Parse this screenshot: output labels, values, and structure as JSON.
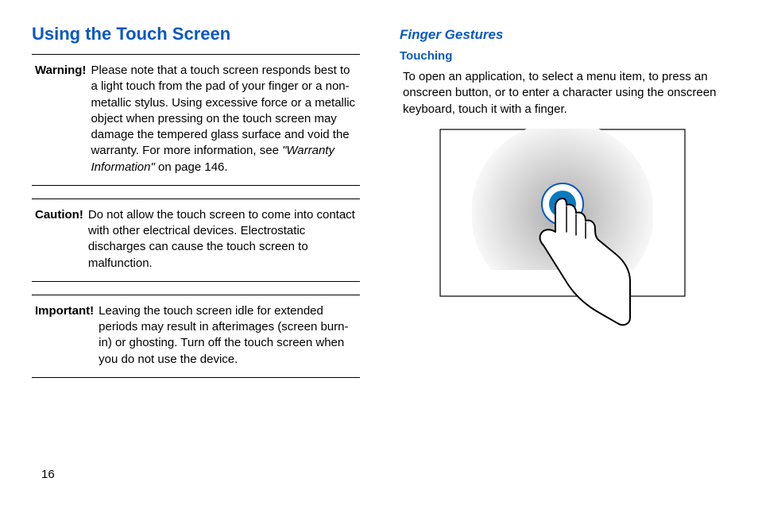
{
  "page_number": "16",
  "left": {
    "section_title": "Using the Touch Screen",
    "warning": {
      "label": "Warning!",
      "text_a": "Please note that a touch screen responds best to a light touch from the pad of your finger or a non-metallic stylus. Using excessive force or a metallic object when pressing on the touch screen may damage the tempered glass surface and void the warranty. For more information, see ",
      "text_i": "\"Warranty Information\"",
      "text_b": " on page 146."
    },
    "caution": {
      "label": "Caution!",
      "text": "Do not allow the touch screen to come into contact with other electrical devices. Electrostatic discharges can cause the touch screen to malfunction."
    },
    "important": {
      "label": "Important!",
      "text": "Leaving the touch screen idle for extended periods may result in afterimages (screen burn-in) or ghosting. Turn off the touch screen when you do not use the device."
    }
  },
  "right": {
    "subsec_title": "Finger Gestures",
    "subsubsec_title": "Touching",
    "paragraph": "To open an application, to select a menu item, to press an onscreen button, or to enter a character using the onscreen keyboard, touch it with a finger."
  }
}
